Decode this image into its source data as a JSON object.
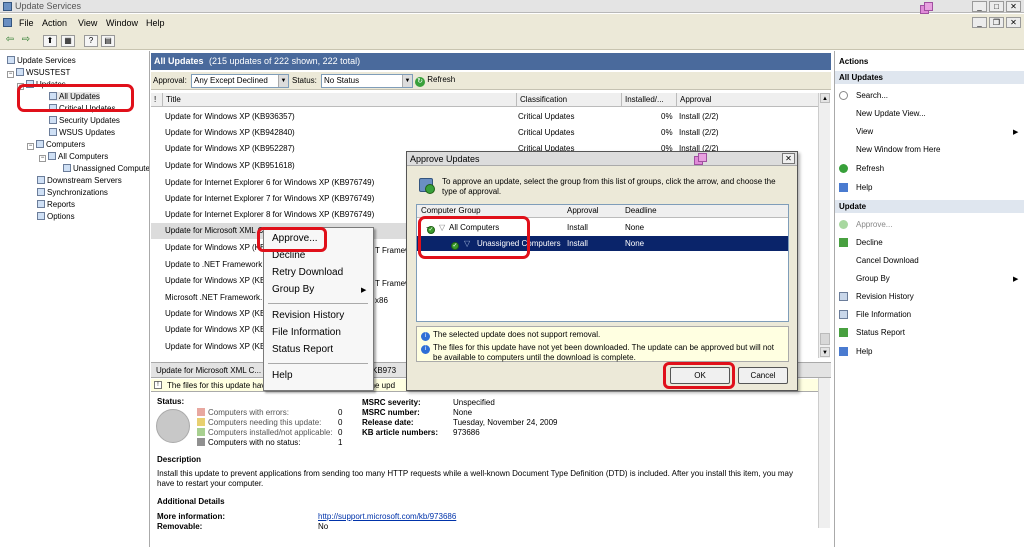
{
  "window": {
    "title": "Update Services"
  },
  "menu": [
    "File",
    "Action",
    "View",
    "Window",
    "Help"
  ],
  "tree": {
    "root": "Update Services",
    "server": "WSUSTEST",
    "updates": "Updates",
    "all_updates": "All Updates",
    "critical_updates": "Critical Updates",
    "security_updates": "Security Updates",
    "wsus_updates": "WSUS Updates",
    "computers": "Computers",
    "all_computers": "All Computers",
    "unassigned": "Unassigned Computers",
    "downstream": "Downstream Servers",
    "sync": "Synchronizations",
    "reports": "Reports",
    "options": "Options"
  },
  "center": {
    "title": "All Updates",
    "count": "(215 updates of 222 shown, 222 total)",
    "approval_label": "Approval:",
    "approval_value": "Any Except Declined",
    "status_label": "Status:",
    "status_value": "No Status",
    "refresh": "Refresh",
    "columns": [
      "Title",
      "Classification",
      "Installed/...",
      "Approval"
    ],
    "rows": [
      {
        "title": "Update for Windows XP (KB936357)",
        "class": "Critical Updates",
        "installed": "0%",
        "approval": "Install (2/2)"
      },
      {
        "title": "Update for Windows XP (KB942840)",
        "class": "Critical Updates",
        "installed": "0%",
        "approval": "Install (2/2)"
      },
      {
        "title": "Update for Windows XP (KB952287)",
        "class": "Critical Updates",
        "installed": "0%",
        "approval": "Install (2/2)"
      },
      {
        "title": "Update for Windows XP (KB951618)",
        "class": "",
        "installed": "",
        "approval": ""
      },
      {
        "title": "Update for Internet Explorer 6 for Windows XP (KB976749)",
        "class": "",
        "installed": "",
        "approval": ""
      },
      {
        "title": "Update for Internet Explorer 7 for Windows XP (KB976749)",
        "class": "",
        "installed": "",
        "approval": ""
      },
      {
        "title": "Update for Internet Explorer 8 for Windows XP (KB976749)",
        "class": "",
        "installed": "",
        "approval": ""
      },
      {
        "title": "Update for Microsoft XML Core Services (KB973686)",
        "class": "",
        "installed": "",
        "approval": ""
      },
      {
        "title": "Update for Windows XP (KB...",
        "class": "",
        "installed": "",
        "approval": ""
      },
      {
        "title": "Update to .NET Framework...",
        "class": "",
        "installed": "",
        "approval": ""
      },
      {
        "title": "Update for Windows XP (KB...",
        "class": "",
        "installed": "",
        "approval": ""
      },
      {
        "title": "Microsoft .NET Framework...",
        "class": "",
        "installed": "",
        "approval": ""
      },
      {
        "title": "Update for Windows XP (KB...",
        "class": "",
        "installed": "",
        "approval": ""
      },
      {
        "title": "Update for Windows XP (KB...",
        "class": "",
        "installed": "",
        "approval": ""
      },
      {
        "title": "Update for Windows XP (KB...",
        "class": "",
        "installed": "",
        "approval": ""
      }
    ],
    "row_partials": {
      "r10": "T Framew",
      "r11": "T Framew",
      "r12": "x86"
    },
    "selected_bar": "Update for Microsoft XML C...",
    "selected_bar_kb": "KB973",
    "info_bar": "The files for this update have not yet been downloaded. The upd"
  },
  "details": {
    "status_label": "Status:",
    "legend": [
      {
        "label": "Computers with errors:",
        "value": "0",
        "color": "#e8a8a0"
      },
      {
        "label": "Computers needing this update:",
        "value": "0",
        "color": "#e8d070"
      },
      {
        "label": "Computers installed/not applicable:",
        "value": "0",
        "color": "#a8d090"
      },
      {
        "label": "Computers with no status:",
        "value": "1",
        "color": "#909090"
      }
    ],
    "fields": [
      {
        "label": "MSRC severity:",
        "value": "Unspecified"
      },
      {
        "label": "MSRC number:",
        "value": "None"
      },
      {
        "label": "Release date:",
        "value": "Tuesday, November 24, 2009"
      },
      {
        "label": "KB article numbers:",
        "value": "973686"
      }
    ],
    "description_label": "Description",
    "description": "Install this update to prevent applications from sending too many HTTP requests while a well-known Document Type Definition (DTD) is included. After you install this item, you may have to restart your computer.",
    "additional_label": "Additional Details",
    "more_info_label": "More information:",
    "more_info_value": "http://support.microsoft.com/kb/973686",
    "removable_label": "Removable:",
    "removable_value": "No"
  },
  "actions": {
    "header": "Actions",
    "section1": "All Updates",
    "items1": [
      "Search...",
      "New Update View...",
      "View",
      "New Window from Here",
      "Refresh",
      "Help"
    ],
    "section2": "Update",
    "items2": [
      "Approve...",
      "Decline",
      "Cancel Download",
      "Group By",
      "Revision History",
      "File Information",
      "Status Report",
      "Help"
    ]
  },
  "context_menu": {
    "items": [
      "Approve...",
      "Decline",
      "Retry Download",
      "Group By",
      "Revision History",
      "File Information",
      "Status Report",
      "Help"
    ]
  },
  "dialog": {
    "title": "Approve Updates",
    "instructions": "To approve an update, select the group from this list of groups, click the arrow, and choose the type of approval.",
    "columns": [
      "Computer Group",
      "Approval",
      "Deadline"
    ],
    "groups": [
      {
        "name": "All Computers",
        "approval": "Install",
        "deadline": "None"
      },
      {
        "name": "Unassigned Computers",
        "approval": "Install",
        "deadline": "None"
      }
    ],
    "msg1": "The selected update does not support removal.",
    "msg2": "The files for this update have not yet been downloaded. The update can be approved but will not be available to computers until the download is complete.",
    "ok": "OK",
    "cancel": "Cancel"
  },
  "colors": {
    "highlight": "#e0101a",
    "header": "#4a6a9c",
    "selection": "#0a246a"
  }
}
